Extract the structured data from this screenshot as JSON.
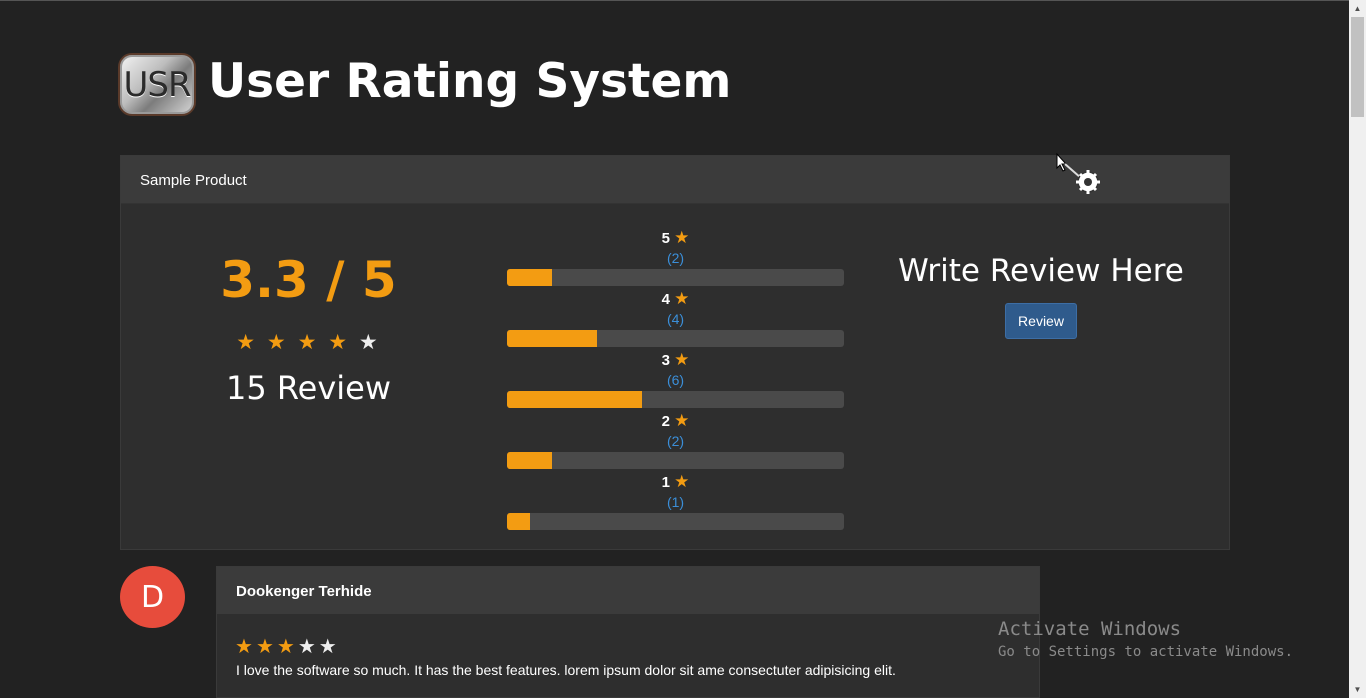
{
  "header": {
    "logo_text": "USR",
    "title": "User Rating System"
  },
  "product": {
    "name": "Sample Product",
    "average_rating": "3.3 / 5",
    "average_value": 3.3,
    "total_reviews_label": "15 Review",
    "stars": [
      "★",
      "★",
      "★",
      "★",
      "★"
    ],
    "breakdown": [
      {
        "stars": "5",
        "count_label": "(2)",
        "count": 2,
        "fraction": 0.133
      },
      {
        "stars": "4",
        "count_label": "(4)",
        "count": 4,
        "fraction": 0.267
      },
      {
        "stars": "3",
        "count_label": "(6)",
        "count": 6,
        "fraction": 0.4
      },
      {
        "stars": "2",
        "count_label": "(2)",
        "count": 2,
        "fraction": 0.133
      },
      {
        "stars": "1",
        "count_label": "(1)",
        "count": 1,
        "fraction": 0.067
      }
    ],
    "write_review_title": "Write Review Here",
    "review_button_label": "Review"
  },
  "reviews": [
    {
      "avatar_letter": "D",
      "name": "Dookenger Terhide",
      "rating": 3,
      "text": "I love the software so much. It has the best features. lorem ipsum dolor sit ame consectuter adipisicing elit."
    }
  ],
  "watermark": {
    "line1": "Activate Windows",
    "line2": "Go to Settings to activate Windows."
  },
  "icons": {
    "star": "star-icon",
    "scroll_up": "chevron-up-icon",
    "scroll_down": "chevron-down-icon",
    "cursor": "busy-cursor-icon"
  },
  "colors": {
    "accent": "#f39c12",
    "count_link": "#3b8fd9",
    "button": "#2f5b8c",
    "avatar": "#e74c3c",
    "background": "#222222",
    "panel": "#2e2e2e"
  }
}
